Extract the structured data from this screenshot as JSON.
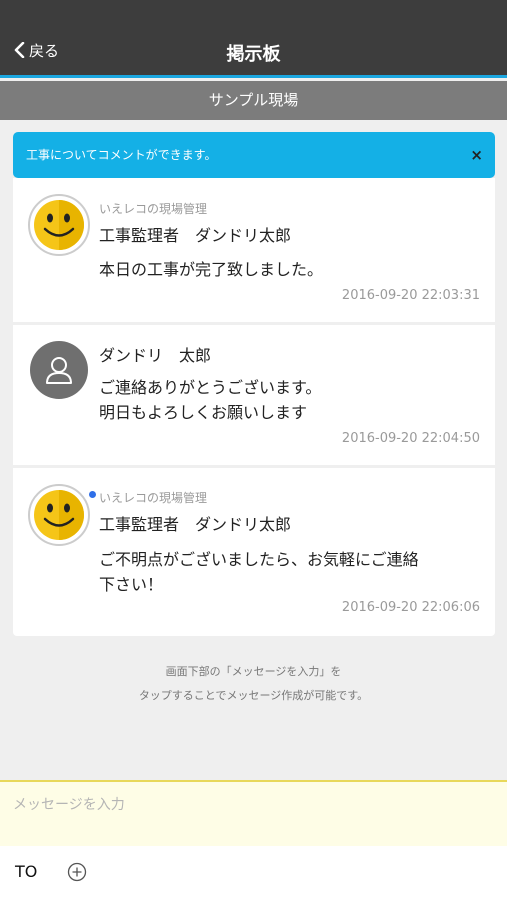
{
  "nav": {
    "back_label": "戻る",
    "title": "掲示板"
  },
  "subheader": "サンプル現場",
  "notice": {
    "text": "工事についてコメントができます。",
    "close": "×"
  },
  "messages": [
    {
      "company": "いえレコの現場管理",
      "name": "工事監理者　ダンドリ太郎",
      "lines": [
        "本日の工事が完了致しました。"
      ],
      "time": "2016-09-20 22:03:31",
      "avatar": "smiley-icon"
    },
    {
      "company": "",
      "name": "ダンドリ　太郎",
      "lines": [
        "ご連絡ありがとうございます。",
        "明日もよろしくお願いします"
      ],
      "time": "2016-09-20 22:04:50",
      "avatar": "person-icon"
    },
    {
      "company": "いえレコの現場管理",
      "name": "工事監理者　ダンドリ太郎",
      "lines": [
        "ご不明点がございましたら、お気軽にご連絡",
        "下さい！"
      ],
      "time": "2016-09-20 22:06:06",
      "avatar": "smiley-icon"
    }
  ],
  "hint": {
    "line1": "画面下部の「メッセージを入力」を",
    "line2": "タップすることでメッセージ作成が可能です。"
  },
  "input": {
    "placeholder": "メッセージを入力"
  },
  "bottom": {
    "to_label": "TO",
    "add_icon": "plus-circle-icon"
  },
  "colors": {
    "accent": "#14b0e6",
    "navbar": "#3d3d3d",
    "subheader": "#7c7c7c",
    "input_bg": "#fefde6",
    "unread_dot": "#2f6fe8"
  }
}
